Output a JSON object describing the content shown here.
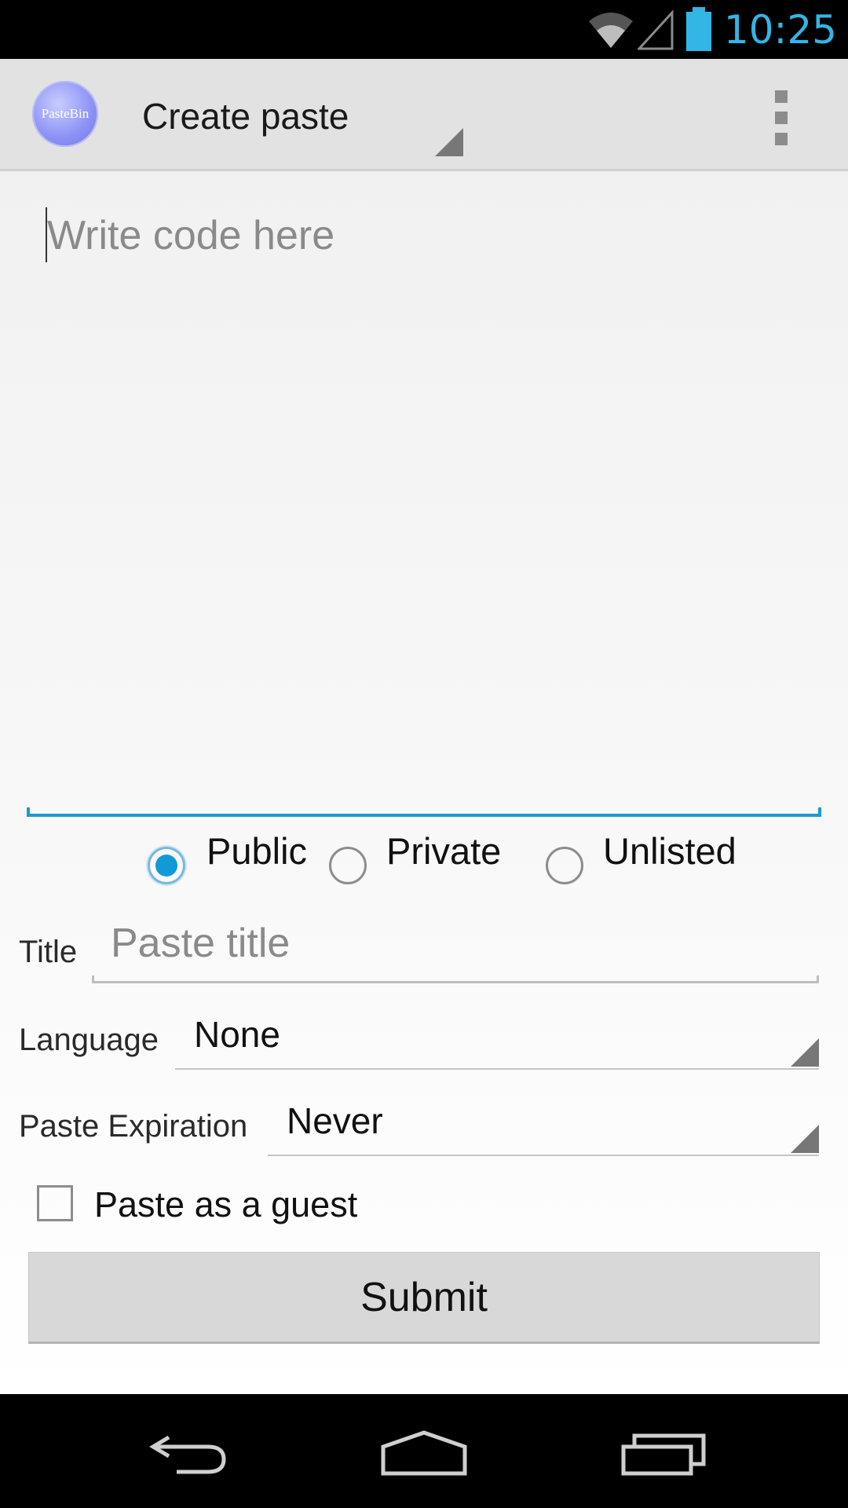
{
  "status_bar": {
    "time": "10:25",
    "icons": [
      "wifi-icon",
      "cell-signal-icon",
      "battery-icon"
    ],
    "accent_color": "#33b5e5"
  },
  "action_bar": {
    "app_logo_text": "PasteBin",
    "title": "Create paste",
    "menu_icon": "overflow-menu-icon"
  },
  "editor": {
    "placeholder": "Write code here",
    "value": "",
    "focus_color": "#1b9bd1"
  },
  "visibility": {
    "options": [
      {
        "label": "Public",
        "checked": true
      },
      {
        "label": "Private",
        "checked": false
      },
      {
        "label": "Unlisted",
        "checked": false
      }
    ]
  },
  "form": {
    "title_label": "Title",
    "title_placeholder": "Paste title",
    "title_value": "",
    "language_label": "Language",
    "language_value": "None",
    "expiration_label": "Paste Expiration",
    "expiration_value": "Never",
    "guest_label": "Paste as a guest",
    "guest_checked": false,
    "submit_label": "Submit"
  },
  "nav_bar": {
    "buttons": [
      "back-icon",
      "home-icon",
      "recent-apps-icon"
    ]
  }
}
